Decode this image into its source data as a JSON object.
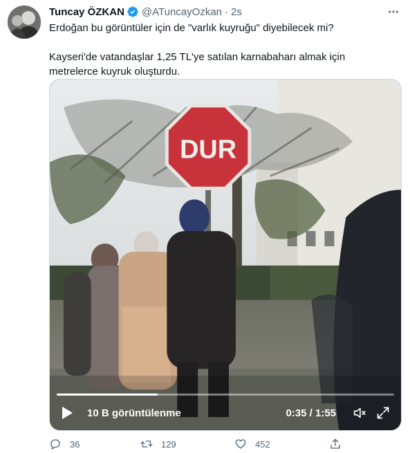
{
  "tweet": {
    "display_name": "Tuncay ÖZKAN",
    "handle": "@ATuncayOzkan",
    "separator": "·",
    "time": "2s",
    "text_line1": "Erdoğan bu görüntüler için de \"varlık kuyruğu\" diyebilecek mi?",
    "text_line2": "Kayseri'de vatandaşlar 1,25 TL'ye satılan karnabaharı almak için",
    "text_line3": "metrelerce kuyruk oluşturdu.",
    "verified_icon": "verified-badge-icon",
    "more_icon": "more-dots-icon"
  },
  "video": {
    "views": "10 B görüntülenme",
    "timecode": "0:35 / 1:55",
    "progress": 0.3,
    "sign_text": "DUR",
    "play_icon": "play-icon",
    "volume_icon": "volume-icon",
    "fullscreen_icon": "fullscreen-icon"
  },
  "actions": {
    "replies": "36",
    "retweets": "129",
    "likes": "452",
    "reply_icon": "reply-icon",
    "retweet_icon": "retweet-icon",
    "like_icon": "heart-icon",
    "share_icon": "share-icon"
  },
  "colors": {
    "verified": "#1d9bf0",
    "muted_text": "#536471",
    "sign_red": "#c8323a"
  }
}
